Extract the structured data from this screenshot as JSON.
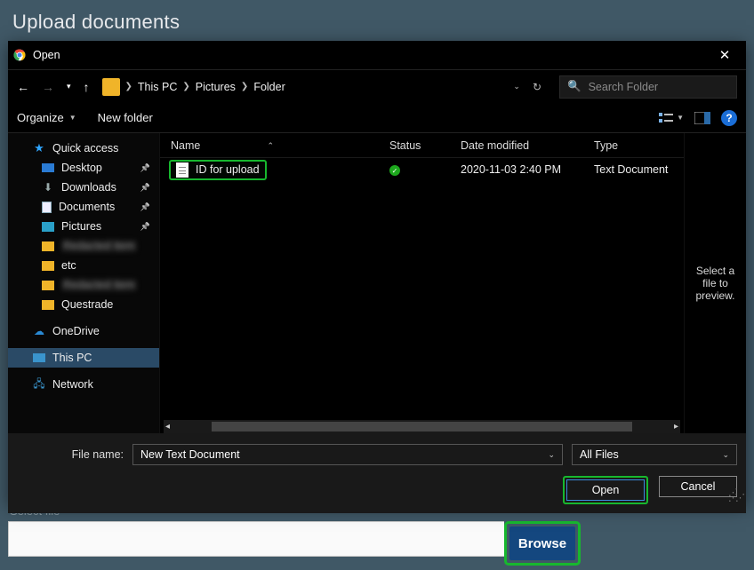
{
  "page": {
    "title": "Upload documents",
    "select_file_label": "Select file",
    "browse_label": "Browse"
  },
  "dialog": {
    "window_title": "Open",
    "breadcrumb": {
      "root": "This PC",
      "p1": "Pictures",
      "p2": "Folder"
    },
    "search": {
      "placeholder": "Search Folder"
    },
    "toolbar": {
      "organize": "Organize",
      "new_folder": "New folder"
    },
    "columns": {
      "name": "Name",
      "status": "Status",
      "date": "Date modified",
      "type": "Type"
    },
    "tree": {
      "quick_access": "Quick access",
      "desktop": "Desktop",
      "downloads": "Downloads",
      "documents": "Documents",
      "pictures": "Pictures",
      "obscured1": "Redacted item",
      "etc": "etc",
      "obscured2": "Redacted item",
      "questrade": "Questrade",
      "onedrive": "OneDrive",
      "this_pc": "This PC",
      "network": "Network"
    },
    "files": [
      {
        "name": "ID for upload",
        "date": "2020-11-03 2:40 PM",
        "type": "Text Document"
      }
    ],
    "preview_hint": "Select a file to preview.",
    "file_name_label": "File name:",
    "file_name_value": "New Text Document",
    "file_filter": "All Files",
    "open_label": "Open",
    "cancel_label": "Cancel"
  }
}
